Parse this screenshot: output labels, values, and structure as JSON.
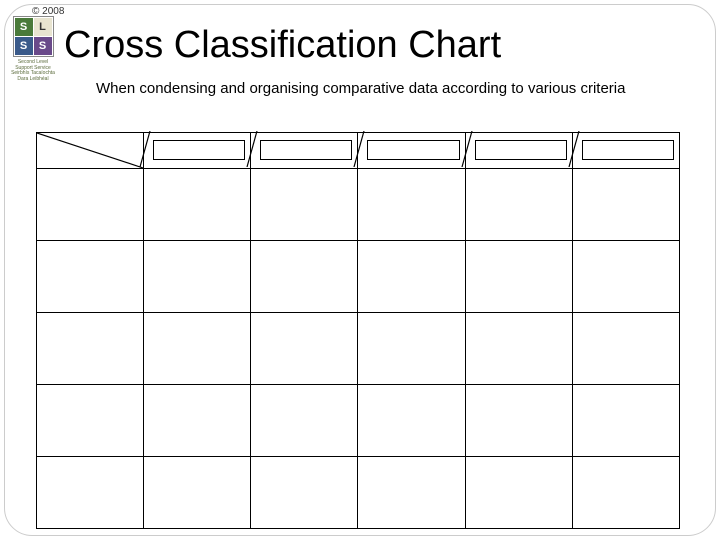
{
  "meta": {
    "copyright": "© 2008"
  },
  "logo": {
    "letters": [
      "S",
      "L",
      "S",
      "S"
    ],
    "caption_line1": "Second Level",
    "caption_line2": "Support Service",
    "caption_line3": "Seirbhís Tacaíochta",
    "caption_line4": "Dara Leibhéal"
  },
  "title": "Cross Classification Chart",
  "subtitle": "When condensing and organising comparative data according to various criteria",
  "chart_data": {
    "type": "table",
    "columns": 6,
    "rows": 5,
    "column_headers": [
      "",
      "",
      "",
      "",
      "",
      ""
    ],
    "row_headers": [
      "",
      "",
      "",
      "",
      ""
    ],
    "cells": [
      [
        "",
        "",
        "",
        "",
        "",
        ""
      ],
      [
        "",
        "",
        "",
        "",
        "",
        ""
      ],
      [
        "",
        "",
        "",
        "",
        "",
        ""
      ],
      [
        "",
        "",
        "",
        "",
        "",
        ""
      ],
      [
        "",
        "",
        "",
        "",
        "",
        ""
      ]
    ],
    "title": "Cross Classification Chart"
  }
}
